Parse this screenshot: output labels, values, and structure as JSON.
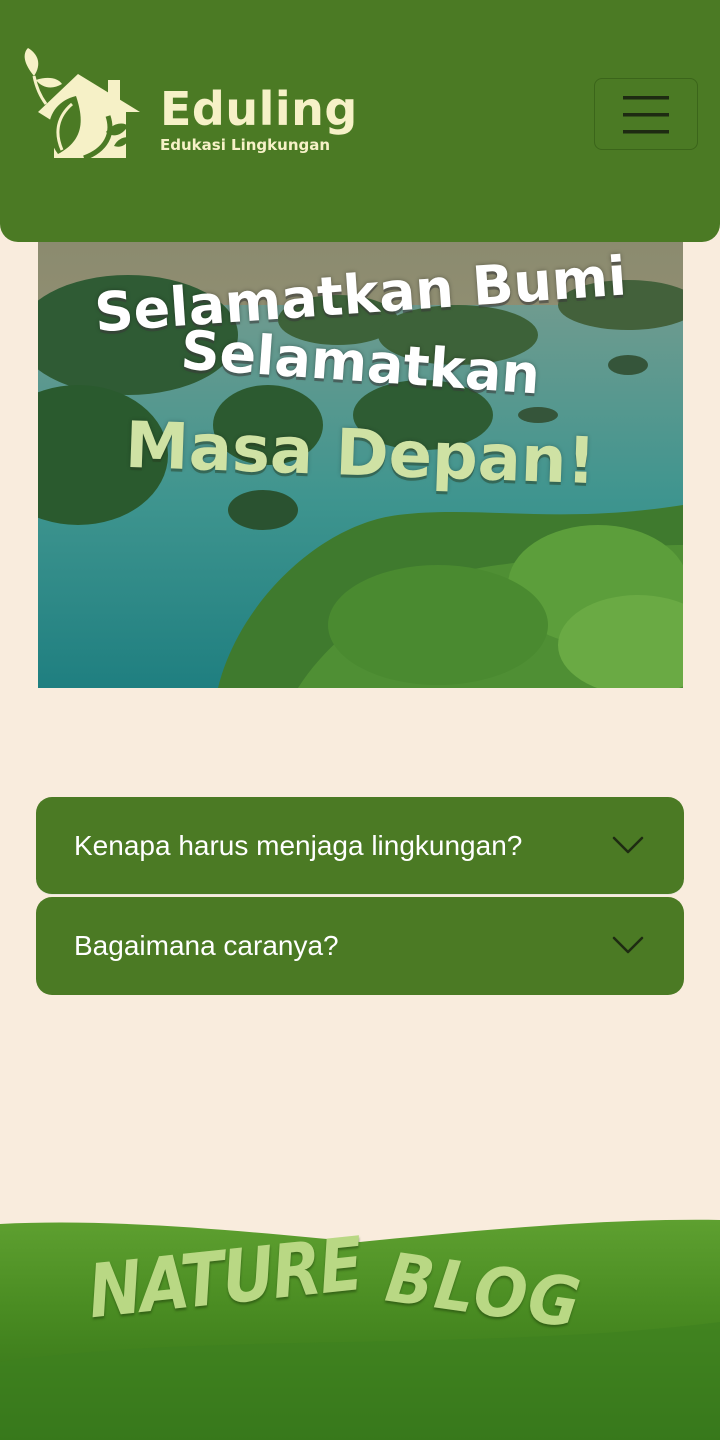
{
  "header": {
    "brand_name": "Eduling",
    "tagline": "Edukasi Lingkungan",
    "logo_icon": "house-leaf-logo-icon",
    "menu_icon": "hamburger-menu-icon"
  },
  "hero": {
    "line1": "Selamatkan Bumi",
    "line2": "Selamatkan",
    "line3": "Masa Depan!"
  },
  "faq": {
    "items": [
      {
        "question": "Kenapa harus menjaga lingkungan?",
        "icon": "chevron-down-icon"
      },
      {
        "question": "Bagaimana caranya?",
        "icon": "chevron-down-icon"
      }
    ]
  },
  "footer": {
    "word1": "NATURE",
    "word2": "BLOG"
  },
  "colors": {
    "primary_green": "#4b7a24",
    "background": "#f9ecdd",
    "logo_cream": "#f6f1c7",
    "hero_accent": "#cfe2a4"
  }
}
